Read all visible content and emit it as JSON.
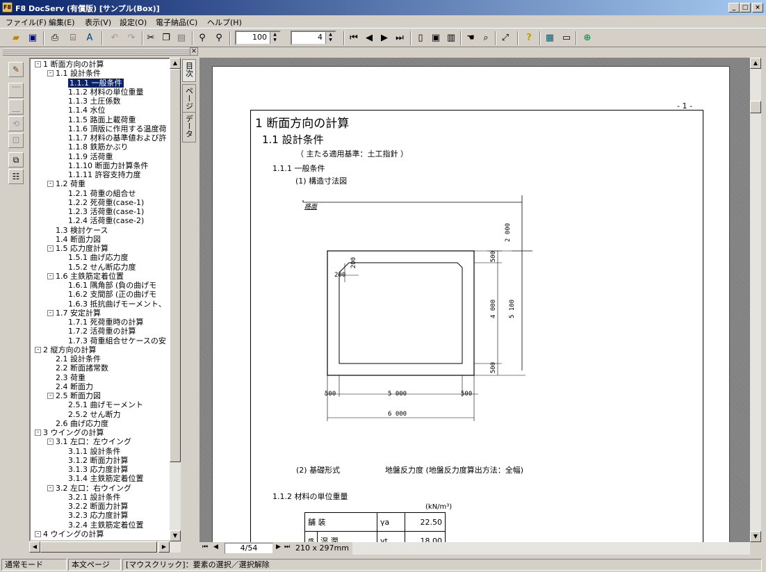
{
  "window": {
    "title": "F8 DocServ (有償版) [サンプル(Box)]",
    "app_icon": "F8",
    "min": "_",
    "max": "□",
    "close": "×"
  },
  "menu": [
    "ファイル(F)",
    "編集(E)",
    "表示(V)",
    "設定(O)",
    "電子納品(C)",
    "ヘルプ(H)"
  ],
  "toolbar": {
    "zoom": "100",
    "page": "4"
  },
  "tabs": [
    "目次",
    "ページ",
    "データ"
  ],
  "tree": [
    {
      "label": "1 断面方向の計算",
      "level": 0,
      "exp": "-"
    },
    {
      "label": "1.1 設計条件",
      "level": 1,
      "exp": "-"
    },
    {
      "label": "1.1.1 一般条件",
      "level": 2,
      "selected": true
    },
    {
      "label": "1.1.2 材料の単位重量",
      "level": 2
    },
    {
      "label": "1.1.3 土圧係数",
      "level": 2
    },
    {
      "label": "1.1.4 水位",
      "level": 2
    },
    {
      "label": "1.1.5 路面上載荷重",
      "level": 2
    },
    {
      "label": "1.1.6 頂版に作用する温度荷",
      "level": 2
    },
    {
      "label": "1.1.7 材料の基準値および許",
      "level": 2
    },
    {
      "label": "1.1.8 鉄筋かぶり",
      "level": 2
    },
    {
      "label": "1.1.9 活荷重",
      "level": 2
    },
    {
      "label": "1.1.10 断面力計算条件",
      "level": 2
    },
    {
      "label": "1.1.11 許容支持力度",
      "level": 2
    },
    {
      "label": "1.2 荷重",
      "level": 1,
      "exp": "-"
    },
    {
      "label": "1.2.1 荷重の組合せ",
      "level": 2
    },
    {
      "label": "1.2.2 死荷重(case-1)",
      "level": 2
    },
    {
      "label": "1.2.3 活荷重(case-1)",
      "level": 2
    },
    {
      "label": "1.2.4 活荷重(case-2)",
      "level": 2
    },
    {
      "label": "1.3 検討ケース",
      "level": 1
    },
    {
      "label": "1.4 断面力図",
      "level": 1
    },
    {
      "label": "1.5 応力度計算",
      "level": 1,
      "exp": "-"
    },
    {
      "label": "1.5.1 曲げ応力度",
      "level": 2
    },
    {
      "label": "1.5.2 せん断応力度",
      "level": 2
    },
    {
      "label": "1.6 主鉄筋定着位置",
      "level": 1,
      "exp": "-"
    },
    {
      "label": "1.6.1 隅角部 (負の曲げモ",
      "level": 2
    },
    {
      "label": "1.6.2 支間部 (正の曲げモ",
      "level": 2
    },
    {
      "label": "1.6.3 抵抗曲げモーメント、",
      "level": 2
    },
    {
      "label": "1.7 安定計算",
      "level": 1,
      "exp": "-"
    },
    {
      "label": "1.7.1 死荷重時の計算",
      "level": 2
    },
    {
      "label": "1.7.2 活荷重の計算",
      "level": 2
    },
    {
      "label": "1.7.3 荷重組合せケースの安",
      "level": 2
    },
    {
      "label": "2 縦方向の計算",
      "level": 0,
      "exp": "-"
    },
    {
      "label": "2.1 設計条件",
      "level": 1
    },
    {
      "label": "2.2 断面諸常数",
      "level": 1
    },
    {
      "label": "2.3 荷重",
      "level": 1
    },
    {
      "label": "2.4 断面力",
      "level": 1
    },
    {
      "label": "2.5 断面力図",
      "level": 1,
      "exp": "-"
    },
    {
      "label": "2.5.1 曲げモーメント",
      "level": 2
    },
    {
      "label": "2.5.2 せん断力",
      "level": 2
    },
    {
      "label": "2.6 曲げ応力度",
      "level": 1
    },
    {
      "label": "3 ウイングの計算",
      "level": 0,
      "exp": "-"
    },
    {
      "label": "3.1 左口：左ウイング",
      "level": 1,
      "exp": "-"
    },
    {
      "label": "3.1.1 設計条件",
      "level": 2
    },
    {
      "label": "3.1.2 断面力計算",
      "level": 2
    },
    {
      "label": "3.1.3 応力度計算",
      "level": 2
    },
    {
      "label": "3.1.4 主鉄筋定着位置",
      "level": 2
    },
    {
      "label": "3.2 左口：右ウイング",
      "level": 1,
      "exp": "-"
    },
    {
      "label": "3.2.1 設計条件",
      "level": 2
    },
    {
      "label": "3.2.2 断面力計算",
      "level": 2
    },
    {
      "label": "3.2.3 応力度計算",
      "level": 2
    },
    {
      "label": "3.2.4 主鉄筋定着位置",
      "level": 2
    },
    {
      "label": "4 ウイングの計算",
      "level": 0,
      "exp": "-"
    }
  ],
  "doc": {
    "page_no": "- 1 -",
    "h1": "1 断面方向の計算",
    "h2": "1.1 設計条件",
    "standard": "（ 主たる適用基準：土工指針 ）",
    "h3": "1.1.1 一般条件",
    "sub1": "(1) 構造寸法図",
    "ground_label": "路面",
    "dims": {
      "fill": "2 000",
      "top": "500",
      "inner_h": "4 000",
      "total_h": "5 100",
      "bottom": "500",
      "haunch_v": "200",
      "haunch_h": "200",
      "left_wall": "500",
      "inner_w": "5 000",
      "right_wall": "500",
      "total_w": "6 000"
    },
    "sub2": "(2) 基礎形式",
    "foundation": "地盤反力度 (地盤反力度算出方法：全幅)",
    "h3b": "1.1.2 材料の単位重量",
    "unit": "(kN/m³)",
    "mat": [
      {
        "name": "舗    装",
        "sym": "γa",
        "val": "22.50"
      },
      {
        "name": "湿    潤",
        "side": "盛",
        "sym": "γt",
        "val": "18.00"
      }
    ]
  },
  "pagebar": {
    "page": "4/54",
    "size": "210 x 297mm"
  },
  "status": [
    "通常モード",
    "本文ページ",
    "[マウスクリック]：要素の選択／選択解除"
  ]
}
